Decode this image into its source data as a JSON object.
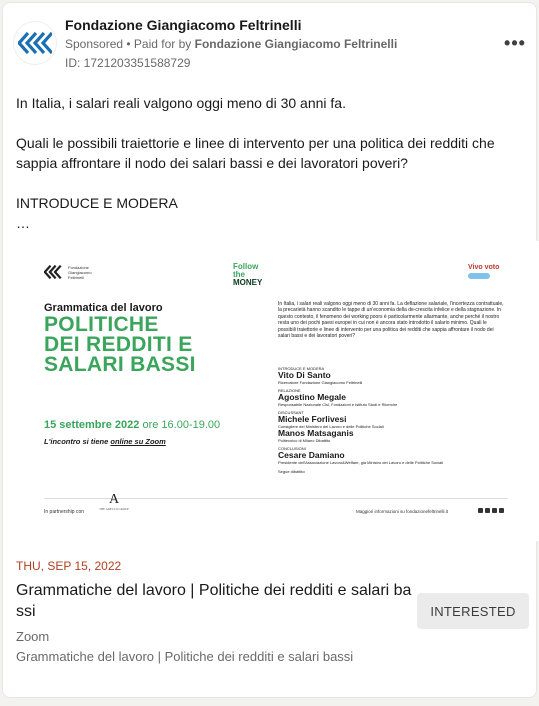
{
  "post": {
    "org_name": "Fondazione Giangiacomo Feltrinelli",
    "sponsored_label": "Sponsored",
    "sponsored_separator": " • Paid for by ",
    "paid_by": "Fondazione Giangiacomo Feltrinelli",
    "ad_id": "ID: 1721203351588729",
    "more_icon": "more-horizontal-icon",
    "text": {
      "p1": "In Italia, i salari reali valgono oggi meno di 30 anni fa.",
      "p2": "Quali le possibili traiettorie e linee di intervento per una politica dei redditi che sappia affrontare il nodo dei salari bassi e dei lavoratori poveri?",
      "p3": "INTRODUCE E MODERA",
      "p4": "…"
    }
  },
  "banner": {
    "logo_text": "Fondazione Giangiacomo Feltrinelli",
    "follow_money": [
      "Follow",
      "the",
      "MONEY"
    ],
    "vivo_label": "Vivo voto",
    "subtitle": "Grammatica del lavoro",
    "title_lines": [
      "POLITICHE",
      "DEI REDDITI E",
      "SALARI BASSI"
    ],
    "date_line": "15 settembre 2022",
    "time_line": "ore 16.00-19.00",
    "zoom_line_pre": "L'incontro si tiene ",
    "zoom_line_link": "online su Zoom",
    "intro_paragraph": "In Italia, i salari reali valgono oggi meno di 30 anni fa. La deflazione salariale, l'incertezza contrattuale, la precarietà hanno scandito le tappe di un'economia della de-crescita infelice e della stagnazione. In questo contesto, il fenomeno dei working poors è particolarmente allarmante, anche perché il nostro resta uno dei pochi paesi europei in cui non è ancora stato introdotto il salario minimo. Quali le possibili traiettorie e linee di intervento per una politica dei redditi che sappia affrontare il nodo dei salari bassi e dei lavoratori poveri?",
    "speakers": [
      {
        "section": "INTRODUCE E MODERA",
        "name": "Vito Di Santo",
        "role": "Ricercatore Fondazione Giangiacomo Feltrinelli"
      },
      {
        "section": "RELAZIONE",
        "name": "Agostino Megale",
        "role": "Responsabile Nazionale Cisl, Fondazioni e Istituto Studi e Ricerche"
      },
      {
        "section": "DISCUSSANT",
        "name": "Michele Forlivesi",
        "role": "Consigliere del Ministero del Lavoro e delle Politiche Sociali"
      },
      {
        "section": "",
        "name": "Manos Matsaganis",
        "role": "Politecnico di Milano Dibattito"
      },
      {
        "section": "CONCLUSIONI",
        "name": "Cesare Damiano",
        "role": "Presidente dell'Associazione Lavoro&Welfare, già Ministro del Lavoro e delle Politiche Sociali"
      }
    ],
    "segue": "Segue dibattito",
    "partnership": "In partnership con",
    "partner_name": "THE ADECCO GROUP",
    "footer_info": "Maggiori informazioni su fondazionefeltrinelli.it"
  },
  "event": {
    "date": "THU, SEP 15, 2022",
    "title": "Grammatiche del lavoro | Politiche dei redditi e salari bassi",
    "place": "Zoom",
    "description": "Grammatiche del lavoro | Politiche dei redditi e salari bassi",
    "interested_label": "INTERESTED"
  },
  "colors": {
    "brand_green": "#3ba55c",
    "date_red": "#b24020",
    "logo_blue": "#1b6fb5"
  }
}
